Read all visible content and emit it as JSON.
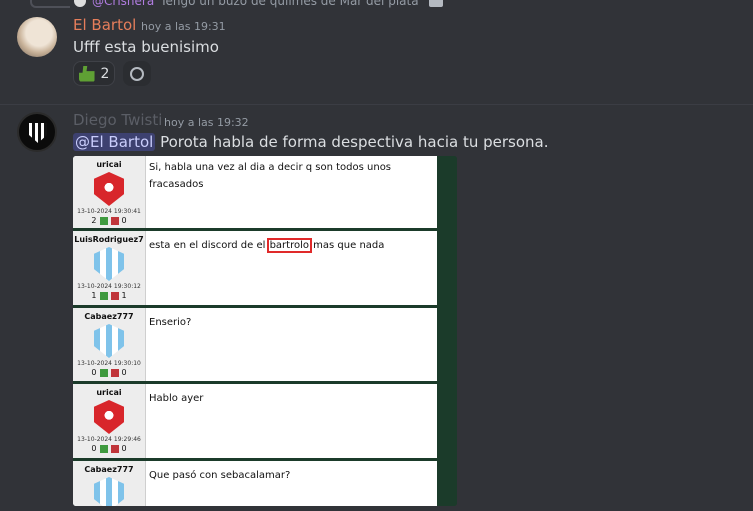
{
  "reply": {
    "mention": "@Crisnera",
    "text": "Tengo un buzo de quilmes de Mar del plata"
  },
  "msg1": {
    "author": "El Bartol",
    "author_color": "#e67e5b",
    "time": "hoy a las 19:31",
    "text": "Ufff esta buenisimo",
    "reaction_count": "2"
  },
  "msg2": {
    "author": "Diego Twisti",
    "author_color": "#5b5e66",
    "time": "hoy a las 19:32",
    "mention": "@El Bartol",
    "text": "Porota habla de forma despectiva hacia tu persona."
  },
  "forum": {
    "posts": [
      {
        "user": "uricai",
        "date": "13-10-2024 19:30:41",
        "up": "2",
        "down": "0",
        "text": "Si, habla una vez al dia a decir q son todos unos fracasados",
        "badge": "red"
      },
      {
        "user": "LuisRodriguez7",
        "date": "13-10-2024 19:30:12",
        "up": "1",
        "down": "1",
        "text_before": "esta en el discord de el ",
        "highlight": "bartrolo",
        "text_after": " mas que nada",
        "badge": "blue"
      },
      {
        "user": "Cabaez777",
        "date": "13-10-2024 19:30:10",
        "up": "0",
        "down": "0",
        "text": "Enserio?",
        "badge": "blue"
      },
      {
        "user": "uricai",
        "date": "13-10-2024 19:29:46",
        "up": "0",
        "down": "0",
        "text": "Hablo ayer",
        "badge": "red"
      },
      {
        "user": "Cabaez777",
        "date": "",
        "up": "",
        "down": "",
        "text": "Que pasó con sebacalamar?",
        "badge": "blue"
      }
    ]
  }
}
